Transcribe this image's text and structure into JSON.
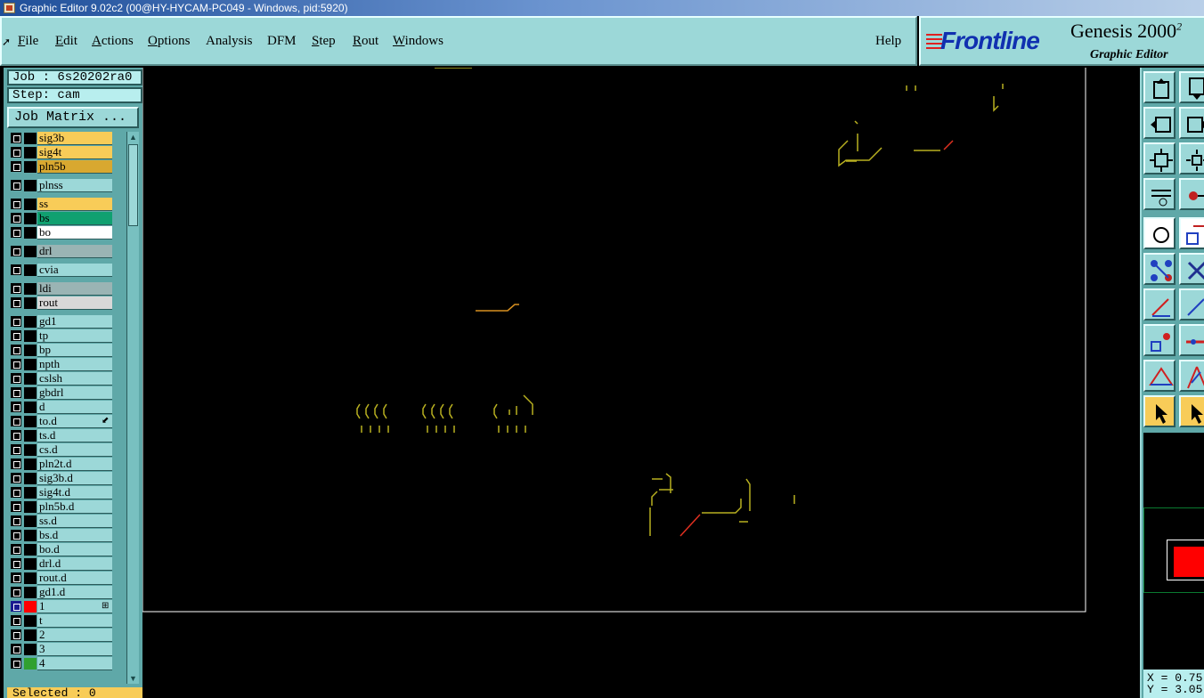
{
  "window": {
    "title": "Graphic Editor 9.02c2 (00@HY-HYCAM-PC049 - Windows, pid:5920)"
  },
  "menu": {
    "items": [
      {
        "label": "File",
        "underline": "F",
        "rest": "ile"
      },
      {
        "label": "Edit",
        "underline": "E",
        "rest": "dit"
      },
      {
        "label": "Actions",
        "underline": "A",
        "rest": "ctions"
      },
      {
        "label": "Options",
        "underline": "O",
        "rest": "ptions"
      },
      {
        "label": "Analysis",
        "underline": "",
        "rest": "Analysis"
      },
      {
        "label": "DFM",
        "underline": "",
        "rest": "DFM"
      },
      {
        "label": "Step",
        "underline": "S",
        "rest": "tep"
      },
      {
        "label": "Rout",
        "underline": "R",
        "rest": "out"
      },
      {
        "label": "Windows",
        "underline": "W",
        "rest": "indows"
      }
    ],
    "help": "Help"
  },
  "logo": {
    "brand": "Frontline",
    "product": "Genesis 2000",
    "product_sup": "2",
    "subtitle": "Graphic Editor"
  },
  "job": {
    "job_label": "Job : 6s20202ra0",
    "step_label": "Step: cam",
    "matrix_button": "Job Matrix ..."
  },
  "layers": [
    {
      "name": "sig3b",
      "bg": "#f8cc58",
      "swatch": "#000000"
    },
    {
      "name": "sig4t",
      "bg": "#f8cc58",
      "swatch": "#000000"
    },
    {
      "name": "pln5b",
      "bg": "#d8a830",
      "swatch": "#000000"
    },
    {
      "name": "plnss",
      "bg": "#9cd8d8",
      "swatch": "#000000"
    },
    {
      "name": "ss",
      "bg": "#f8cc58",
      "swatch": "#000000"
    },
    {
      "name": "bs",
      "bg": "#10a070",
      "swatch": "#000000"
    },
    {
      "name": "bo",
      "bg": "#ffffff",
      "swatch": "#000000"
    },
    {
      "name": "drl",
      "bg": "#9ab4b4",
      "swatch": "#000000"
    },
    {
      "name": "cvia",
      "bg": "#9cd8d8",
      "swatch": "#000000"
    },
    {
      "name": "ldi",
      "bg": "#9ab4b4",
      "swatch": "#000000"
    },
    {
      "name": "rout",
      "bg": "#d8d8d8",
      "swatch": "#000000"
    },
    {
      "name": "gd1",
      "bg": "#9cd8d8",
      "swatch": "#000000"
    },
    {
      "name": "tp",
      "bg": "#9cd8d8",
      "swatch": "#000000"
    },
    {
      "name": "bp",
      "bg": "#9cd8d8",
      "swatch": "#000000"
    },
    {
      "name": "npth",
      "bg": "#9cd8d8",
      "swatch": "#000000"
    },
    {
      "name": "cslsh",
      "bg": "#9cd8d8",
      "swatch": "#000000"
    },
    {
      "name": "gbdrl",
      "bg": "#9cd8d8",
      "swatch": "#000000"
    },
    {
      "name": "d",
      "bg": "#9cd8d8",
      "swatch": "#000000"
    },
    {
      "name": "to.d",
      "bg": "#9cd8d8",
      "swatch": "#000000",
      "mark": "⬋"
    },
    {
      "name": "ts.d",
      "bg": "#9cd8d8",
      "swatch": "#000000"
    },
    {
      "name": "cs.d",
      "bg": "#9cd8d8",
      "swatch": "#000000"
    },
    {
      "name": "pln2t.d",
      "bg": "#9cd8d8",
      "swatch": "#000000"
    },
    {
      "name": "sig3b.d",
      "bg": "#9cd8d8",
      "swatch": "#000000"
    },
    {
      "name": "sig4t.d",
      "bg": "#9cd8d8",
      "swatch": "#000000"
    },
    {
      "name": "pln5b.d",
      "bg": "#9cd8d8",
      "swatch": "#000000"
    },
    {
      "name": "ss.d",
      "bg": "#9cd8d8",
      "swatch": "#000000"
    },
    {
      "name": "bs.d",
      "bg": "#9cd8d8",
      "swatch": "#000000"
    },
    {
      "name": "bo.d",
      "bg": "#9cd8d8",
      "swatch": "#000000"
    },
    {
      "name": "drl.d",
      "bg": "#9cd8d8",
      "swatch": "#000000"
    },
    {
      "name": "rout.d",
      "bg": "#9cd8d8",
      "swatch": "#000000"
    },
    {
      "name": "gd1.d",
      "bg": "#9cd8d8",
      "swatch": "#000000"
    },
    {
      "name": "1",
      "bg": "#9cd8d8",
      "swatch": "#ff0000",
      "cb": "#1a1a90",
      "mark": "⊞"
    },
    {
      "name": "t",
      "bg": "#9cd8d8",
      "swatch": "#000000"
    },
    {
      "name": "2",
      "bg": "#9cd8d8",
      "swatch": "#000000"
    },
    {
      "name": "3",
      "bg": "#9cd8d8",
      "swatch": "#000000"
    },
    {
      "name": "4",
      "bg": "#9cd8d8",
      "swatch": "#30a030"
    }
  ],
  "status": {
    "selected": "Selected : 0"
  },
  "coords": {
    "x": "X = 0.75",
    "y": "Y = 3.05"
  },
  "tools": [
    "move-up-icon",
    "move-down-icon",
    "move-left-icon",
    "move-right-icon",
    "fit-frame-icon",
    "zoom-fit-icon",
    "measure-icon",
    "snap-icon",
    "pad-select-icon",
    "feature-copy-icon",
    "net-select-icon",
    "cross-icon",
    "line-red-icon",
    "line-blue-icon",
    "move-feature-icon",
    "arrow-line-icon",
    "triangle-icon",
    "triangle-arrow-icon",
    "select-cursor-icon",
    "select-cursor-active-icon"
  ],
  "colors": {
    "panel": "#9cd8d8",
    "panel_dark": "#5fa8a8",
    "canvas": "#000000",
    "trace": "#b8b020",
    "trace_red": "#e03020"
  }
}
